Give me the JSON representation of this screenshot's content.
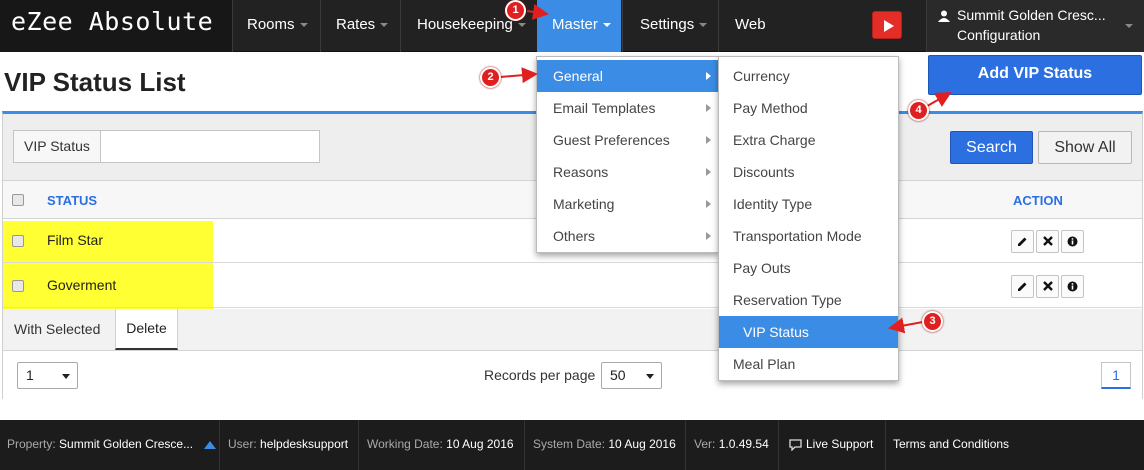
{
  "app": {
    "brand": "eZee Absolute"
  },
  "nav": {
    "items": [
      {
        "label": "Rooms"
      },
      {
        "label": "Rates"
      },
      {
        "label": "Housekeeping"
      },
      {
        "label": "Master"
      },
      {
        "label": "Settings"
      },
      {
        "label": "Web"
      }
    ],
    "active": "Master",
    "user_property": "Summit Golden Cresc...",
    "user_section": "Configuration"
  },
  "page": {
    "title": "VIP Status List",
    "add_button": "Add VIP Status"
  },
  "filter": {
    "label": "VIP Status",
    "value": "",
    "search_button": "Search",
    "show_all_button": "Show All"
  },
  "table": {
    "columns": {
      "status": "STATUS",
      "action": "ACTION"
    },
    "rows": [
      {
        "status": "Film Star"
      },
      {
        "status": "Goverment"
      }
    ],
    "with_selected": "With Selected",
    "delete_button": "Delete"
  },
  "pager": {
    "page_select": "1",
    "records_label": "Records per page",
    "records_value": "50",
    "current_page": "1"
  },
  "master_menu": {
    "items": [
      "General",
      "Email Templates",
      "Guest Preferences",
      "Reasons",
      "Marketing",
      "Others"
    ],
    "selected": "General"
  },
  "general_submenu": {
    "items": [
      "Currency",
      "Pay Method",
      "Extra Charge",
      "Discounts",
      "Identity Type",
      "Transportation Mode",
      "Pay Outs",
      "Reservation Type",
      "VIP Status",
      "Meal Plan"
    ],
    "selected": "VIP Status"
  },
  "annotations": [
    "1",
    "2",
    "3",
    "4"
  ],
  "footer": {
    "property_label": "Property:",
    "property_value": "Summit Golden Cresce...",
    "user_label": "User:",
    "user_value": "helpdesksupport",
    "working_date_label": "Working Date:",
    "working_date_value": "10 Aug 2016",
    "system_date_label": "System Date:",
    "system_date_value": "10 Aug 2016",
    "version_label": "Ver:",
    "version_value": "1.0.49.54",
    "live_support": "Live Support",
    "terms": "Terms and Conditions"
  },
  "colors": {
    "accent": "#3b8ce5",
    "button_primary": "#2c6fe0",
    "annotation_badge": "#e02020",
    "highlight": "#ffff33",
    "nav_bg": "#222222"
  }
}
